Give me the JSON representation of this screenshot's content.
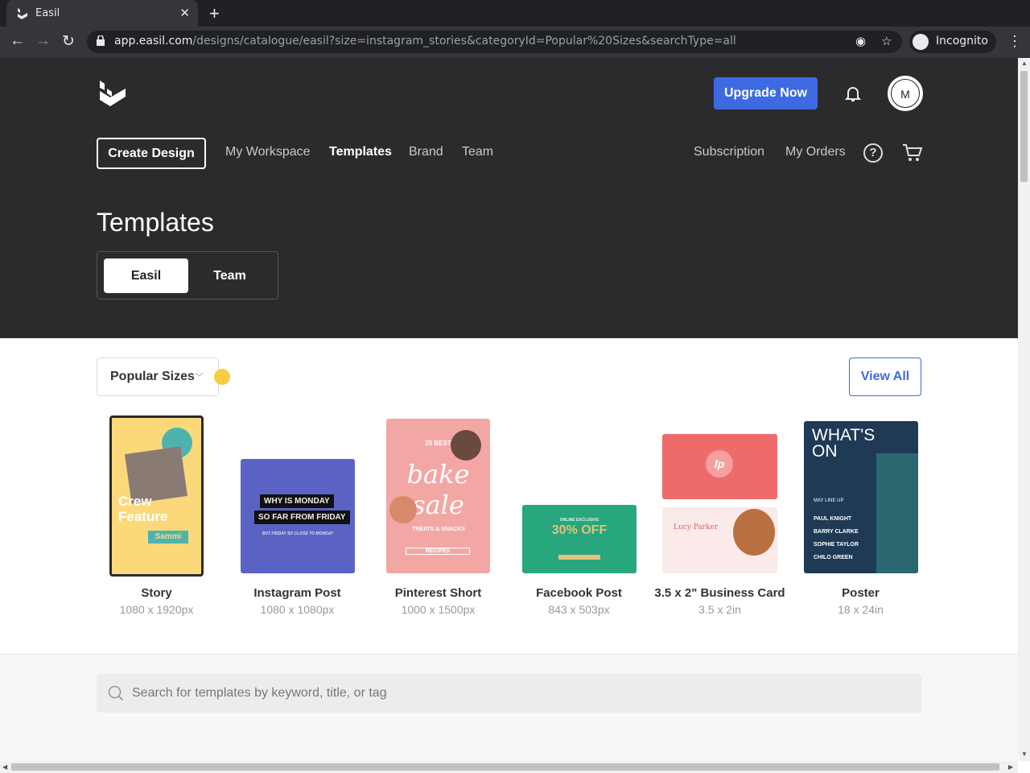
{
  "browser": {
    "tab_title": "Easil",
    "url_host": "app.easil.com",
    "url_path": "/designs/catalogue/easil?size=instagram_stories&categoryId=Popular%20Sizes&searchType=all",
    "incognito_label": "Incognito"
  },
  "header": {
    "upgrade_label": "Upgrade Now",
    "avatar_initial": "M",
    "create_label": "Create Design",
    "nav": [
      "My Workspace",
      "Templates",
      "Brand",
      "Team"
    ],
    "right_nav": [
      "Subscription",
      "My Orders"
    ],
    "help_glyph": "?",
    "page_title": "Templates",
    "toggle": [
      "Easil",
      "Team"
    ]
  },
  "filters": {
    "popular_sizes_label": "Popular Sizes",
    "view_all_label": "View All"
  },
  "sizes": [
    {
      "name": "Story",
      "dims": "1080 x 1920px",
      "thumb_text": [
        "Crew",
        "Feature",
        "Sammi"
      ]
    },
    {
      "name": "Instagram Post",
      "dims": "1080 x 1080px",
      "thumb_text": [
        "WHY IS MONDAY",
        "SO FAR FROM FRIDAY",
        "BUT FRIDAY SO CLOSE TO MONDAY"
      ]
    },
    {
      "name": "Pinterest Short",
      "dims": "1000 x 1500px",
      "thumb_text": [
        "25 BEST",
        "bake sale",
        "TREATS & SNACKS",
        "RECIPES"
      ]
    },
    {
      "name": "Facebook Post",
      "dims": "843 x 503px",
      "thumb_text": [
        "ONLINE EXCLUSIVE",
        "30% OFF"
      ]
    },
    {
      "name": "3.5 x 2\" Business Card",
      "dims": "3.5 x 2in",
      "thumb_text": [
        "lp",
        "Lucy Parker"
      ]
    },
    {
      "name": "Poster",
      "dims": "18 x 24in",
      "thumb_text": [
        "WHAT'S ON",
        "MAY LINE UP",
        "PAUL KNIGHT",
        "BARRY CLARKE",
        "SOPHIE TAYLOR",
        "CHILO GREEN"
      ]
    }
  ],
  "search": {
    "placeholder": "Search for templates by keyword, title, or tag",
    "value": ""
  },
  "colors": {
    "accent": "#3e6ae1",
    "header_bg": "#2b2b2d",
    "dot": "#f5cd3d"
  }
}
